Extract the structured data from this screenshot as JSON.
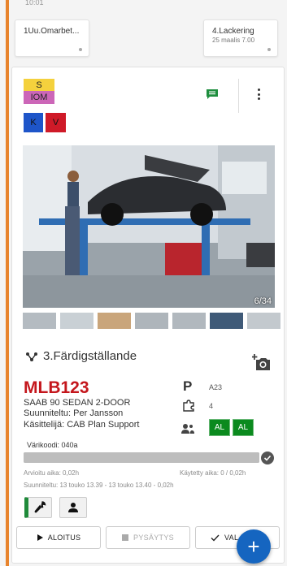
{
  "top_strip_text": "10:01",
  "steps": [
    {
      "title": "1Uu.Omarbet...",
      "subtitle": ""
    },
    {
      "title": "4.Lackering",
      "subtitle": "25 maalis 7.00"
    }
  ],
  "tags": {
    "s": "S",
    "iom": "IOM",
    "k": "K",
    "v": "V"
  },
  "tag_colors": {
    "s": "#f4d13d",
    "iom": "#cc66b8",
    "k": "#1e55c9",
    "v": "#cf1a28"
  },
  "photo": {
    "counter": "6/34"
  },
  "thumbnails_count": 7,
  "stage": {
    "title": "3.Färdigställande"
  },
  "vehicle": {
    "reg": "MLB123",
    "model": "SAAB 90 SEDAN 2-DOOR",
    "planned_by": "Suunniteltu: Per Jansson",
    "handler": "Käsittelijä: CAB Plan Support"
  },
  "side_info": {
    "p_letter": "P",
    "p_value": "A23",
    "parts_value": "4",
    "assignees": [
      "AL",
      "AL"
    ]
  },
  "color_code": "Värikoodi: 040a",
  "progress_fraction": 1.0,
  "estimated_time": "Arvioitu aika: 0,02h",
  "used_time": "Käytetty aika: 0 / 0,02h",
  "planned": "Suunniteltu: 13 touko 13.39 - 13 touko 13.40 - 0,02h",
  "actions": {
    "start": "ALOITUS",
    "pause": "PYSÄYTYS",
    "ready": "VAL"
  },
  "fab_label": "+",
  "colors": {
    "accent_orange": "#e8842d",
    "reg_red": "#c4161c",
    "green": "#0b8a1e",
    "fab_blue": "#1565c0"
  }
}
